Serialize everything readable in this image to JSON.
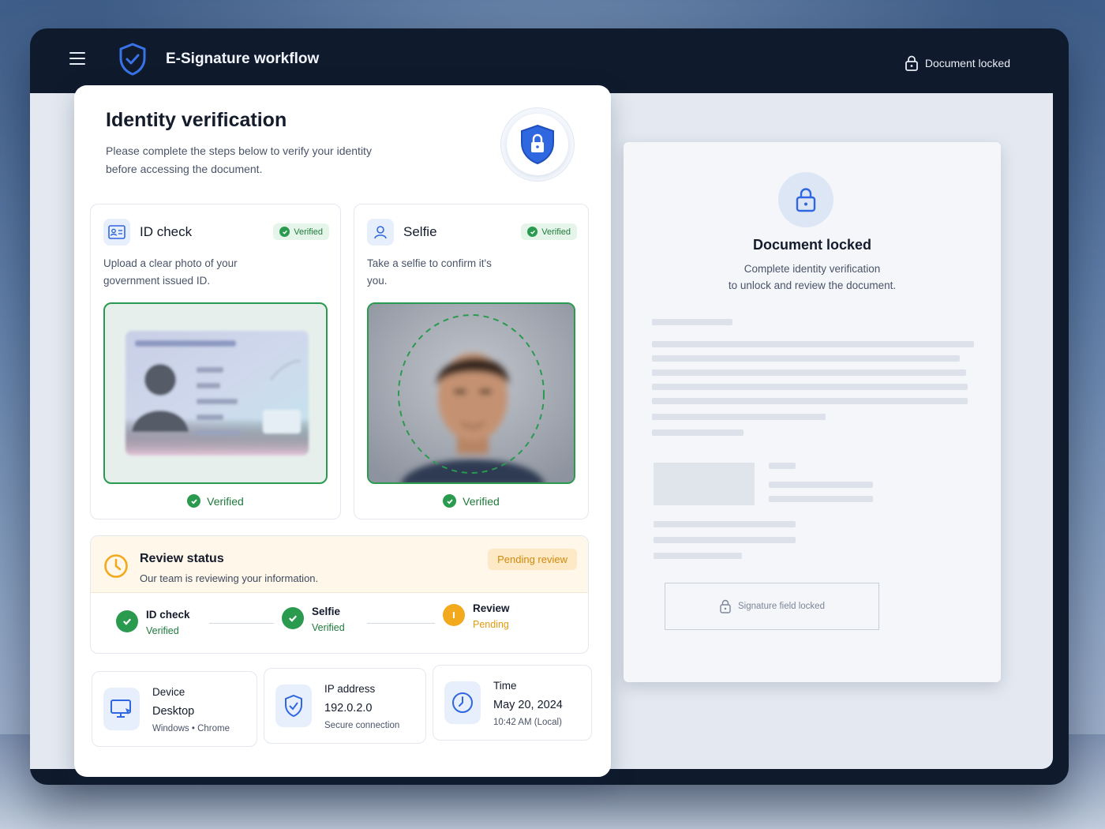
{
  "app": {
    "title": "E-Signature workflow",
    "status": "Document locked"
  },
  "verification": {
    "title": "Identity verification",
    "subtitle": "Please complete the steps below to verify your identity before accessing the document."
  },
  "id_check": {
    "title": "ID check",
    "badge": "Verified",
    "description": "Upload a clear photo of your government issued ID.",
    "footer": "Verified"
  },
  "selfie": {
    "title": "Selfie",
    "badge": "Verified",
    "description": "Take a selfie to confirm it's you.",
    "footer": "Verified"
  },
  "review": {
    "title": "Review status",
    "subtitle": "Our team is reviewing your information.",
    "pill": "Pending review",
    "steps": [
      {
        "name": "ID check",
        "state": "Verified"
      },
      {
        "name": "Selfie",
        "state": "Verified"
      },
      {
        "name": "Review",
        "state": "Pending"
      }
    ]
  },
  "meta": {
    "device": {
      "label": "Device",
      "value": "Desktop",
      "sub": "Windows • Chrome"
    },
    "ip": {
      "label": "IP address",
      "value": "192.0.2.0",
      "sub": "Secure connection"
    },
    "time": {
      "label": "Time",
      "value": "May 20, 2024",
      "sub": "10:42 AM (Local)"
    }
  },
  "document": {
    "title": "Document locked",
    "subtitle_line1": "Complete identity verification",
    "subtitle_line2": "to unlock and review the document.",
    "signature": "Signature field locked"
  },
  "colors": {
    "accent": "#2f67e0",
    "success": "#2a9a4e",
    "pending": "#f2a91c",
    "frame": "#0f1a2d"
  },
  "icons": [
    "menu-icon",
    "shield-check-icon",
    "lock-icon",
    "shield-lock-icon",
    "id-card-icon",
    "user-icon",
    "check-icon",
    "clock-icon",
    "monitor-icon",
    "shield-icon"
  ]
}
